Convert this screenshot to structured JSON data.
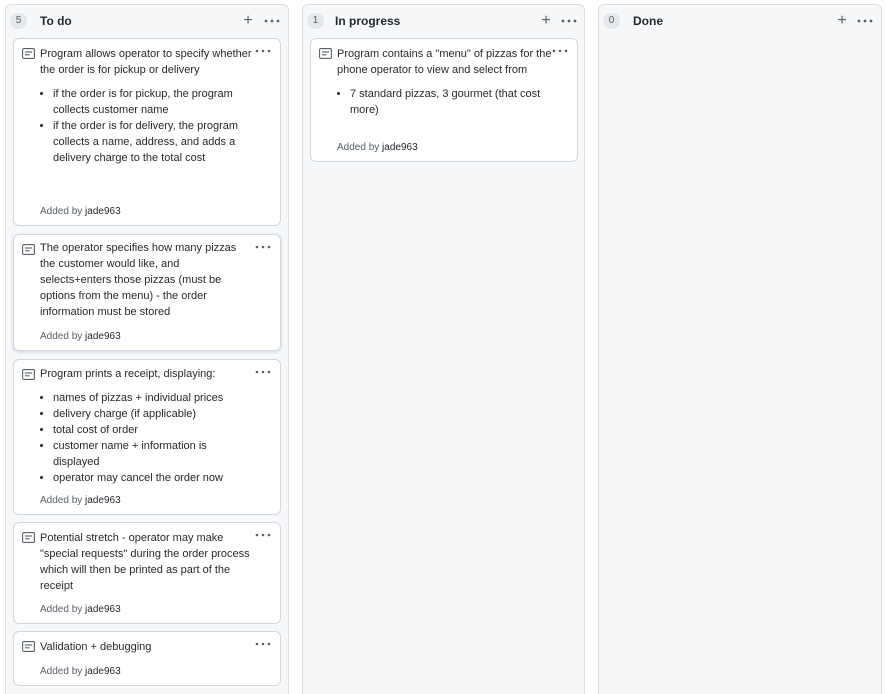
{
  "columns": [
    {
      "count": "5",
      "title": "To do",
      "cards": [
        {
          "paragraphs": [
            "Program allows operator to specify whether the order is for pickup or delivery"
          ],
          "bullets": [
            "if the order is for pickup, the program collects customer name",
            "if the order is for delivery, the program collects a name, address, and adds a delivery charge to the total cost"
          ],
          "added_by_label": "Added by",
          "author": "jade963"
        },
        {
          "paragraphs": [
            "The operator specifies how many pizzas the customer would like, and selects+enters those pizzas (must be options from the menu) - the order information must be stored"
          ],
          "bullets": [],
          "added_by_label": "Added by",
          "author": "jade963"
        },
        {
          "paragraphs": [
            "Program prints a receipt, displaying:"
          ],
          "bullets": [
            "names of pizzas + individual prices",
            "delivery charge (if applicable)",
            "total cost of order",
            "customer name + information is displayed",
            "operator may cancel the order now"
          ],
          "added_by_label": "Added by",
          "author": "jade963"
        },
        {
          "paragraphs": [
            "Potential stretch - operator may make \"special requests\" during the order process which will then be printed as part of the receipt"
          ],
          "bullets": [],
          "added_by_label": "Added by",
          "author": "jade963"
        },
        {
          "paragraphs": [
            "Validation + debugging"
          ],
          "bullets": [],
          "added_by_label": "Added by",
          "author": "jade963"
        }
      ]
    },
    {
      "count": "1",
      "title": "In progress",
      "cards": [
        {
          "paragraphs": [
            "Program contains a \"menu\" of pizzas for the phone operator to view and select from"
          ],
          "bullets": [
            "7 standard pizzas, 3 gourmet (that cost more)"
          ],
          "added_by_label": "Added by",
          "author": "jade963"
        }
      ]
    },
    {
      "count": "0",
      "title": "Done",
      "cards": []
    }
  ],
  "icons": {
    "add": "plus-icon",
    "menu": "kebab-horizontal-icon",
    "note": "note-icon"
  },
  "colors": {
    "column_bg": "#f6f8fa",
    "border": "#d0d7de",
    "muted_text": "#57606a"
  }
}
